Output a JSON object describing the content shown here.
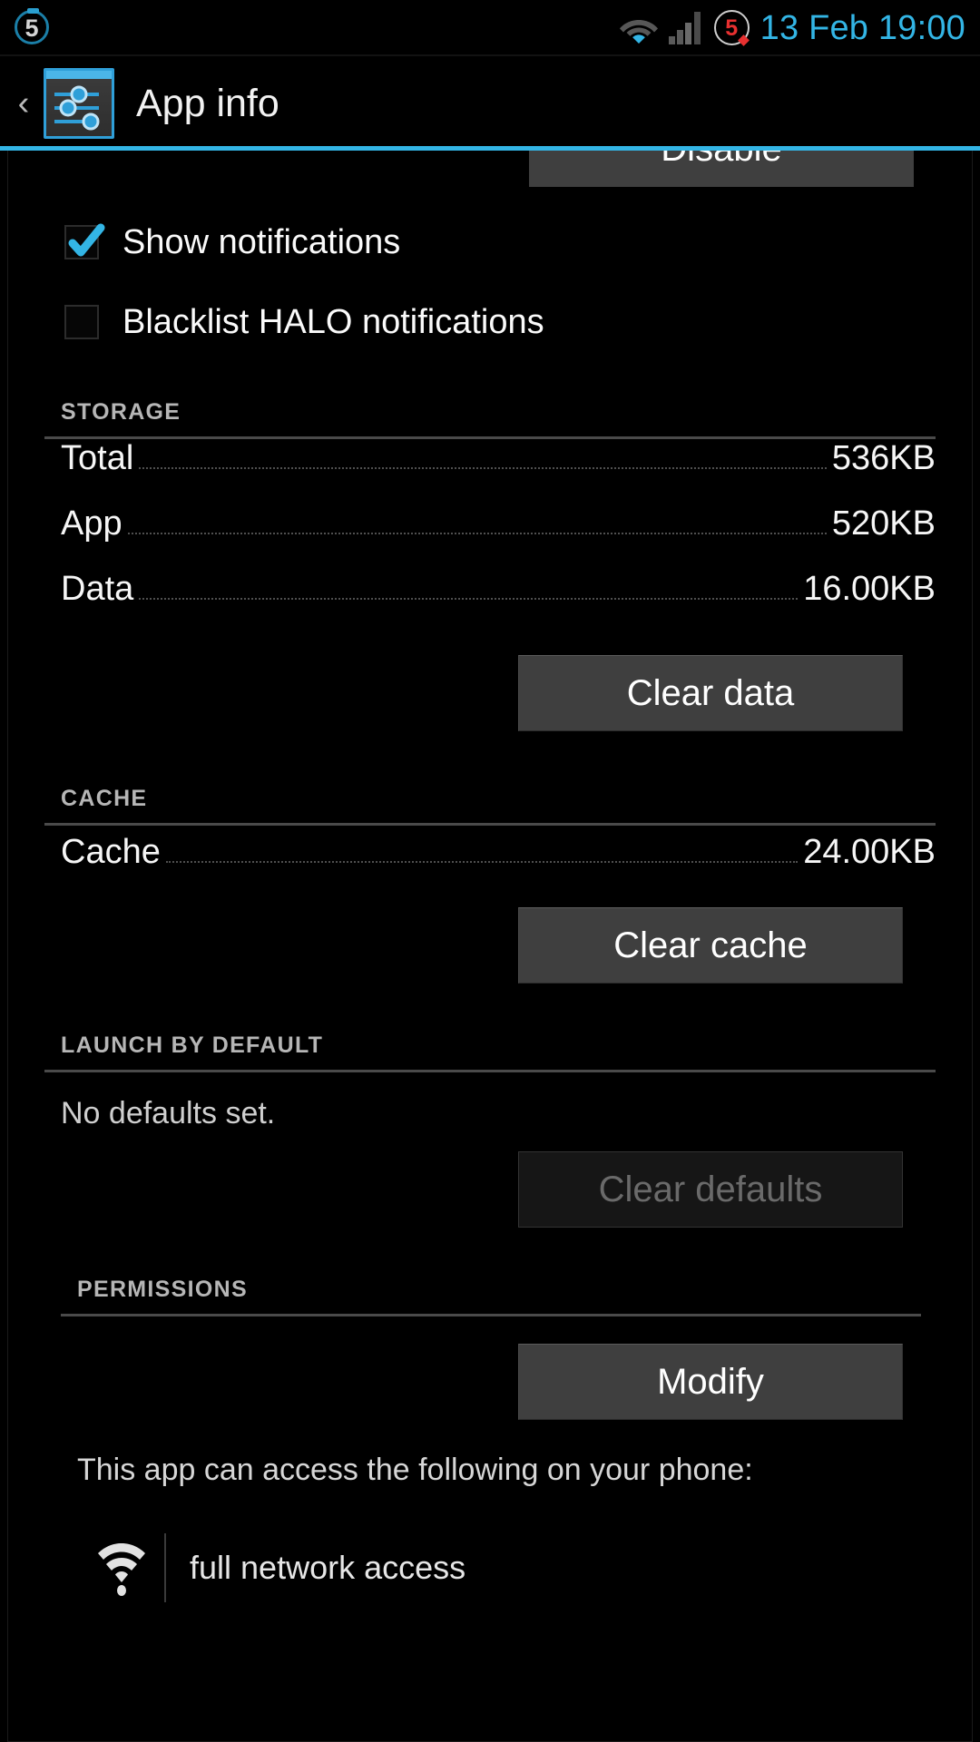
{
  "statusbar": {
    "battery_level": "5",
    "notification_count": "5",
    "clock": "13 Feb 19:00",
    "wifi_icon": "wifi-icon",
    "signal_icon": "cellular-signal-icon",
    "battery_icon": "battery-circle-icon",
    "alarm_icon": "alarm-count-icon",
    "clock_color": "#33b5e5"
  },
  "actionbar": {
    "back_label": "‹",
    "title": "App info",
    "app_icon": "settings-sliders-icon",
    "accent_color": "#33b5e5"
  },
  "content": {
    "clipped_button": {
      "label": "Disable"
    },
    "checkboxes": [
      {
        "label": "Show notifications",
        "checked": true
      },
      {
        "label": "Blacklist HALO notifications",
        "checked": false
      }
    ],
    "storage": {
      "header": "STORAGE",
      "rows": [
        {
          "label": "Total",
          "value": "536KB"
        },
        {
          "label": "App",
          "value": "520KB"
        },
        {
          "label": "Data",
          "value": "16.00KB"
        }
      ],
      "button": {
        "label": "Clear data",
        "enabled": true
      }
    },
    "cache": {
      "header": "CACHE",
      "rows": [
        {
          "label": "Cache",
          "value": "24.00KB"
        }
      ],
      "button": {
        "label": "Clear cache",
        "enabled": true
      }
    },
    "launch_by_default": {
      "header": "LAUNCH BY DEFAULT",
      "status_text": "No defaults set.",
      "button": {
        "label": "Clear defaults",
        "enabled": false
      }
    },
    "permissions": {
      "header": "PERMISSIONS",
      "button": {
        "label": "Modify",
        "enabled": true
      },
      "intro": "This app can access the following on your phone:",
      "items": [
        {
          "icon": "network-access-icon",
          "label": "full network access"
        }
      ]
    }
  }
}
